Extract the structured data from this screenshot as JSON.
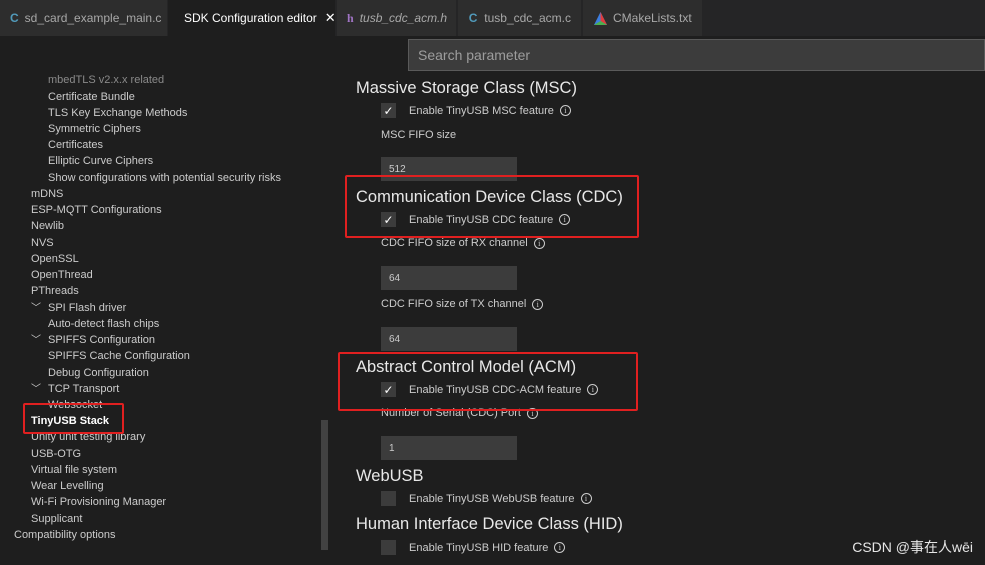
{
  "tabs": [
    {
      "label": "sd_card_example_main.c",
      "icon": "c-file-icon"
    },
    {
      "label": "SDK Configuration editor",
      "icon": "espressif-icon",
      "close": "✕"
    },
    {
      "label": "tusb_cdc_acm.h",
      "icon": "h-file-icon"
    },
    {
      "label": "tusb_cdc_acm.c",
      "icon": "c-file-icon"
    },
    {
      "label": "CMakeLists.txt",
      "icon": "cmake-icon"
    }
  ],
  "search": {
    "placeholder": "Search parameter"
  },
  "sidebar": {
    "items": [
      "mbedTLS v2.x.x related",
      "Certificate Bundle",
      "TLS Key Exchange Methods",
      "Symmetric Ciphers",
      "Certificates",
      "Elliptic Curve Ciphers",
      "Show configurations with potential security risks",
      "mDNS",
      "ESP-MQTT Configurations",
      "Newlib",
      "NVS",
      "OpenSSL",
      "OpenThread",
      "PThreads",
      "SPI Flash driver",
      "Auto-detect flash chips",
      "SPIFFS Configuration",
      "SPIFFS Cache Configuration",
      "Debug Configuration",
      "TCP Transport",
      "Websocket",
      "TinyUSB Stack",
      "Unity unit testing library",
      "USB-OTG",
      "Virtual file system",
      "Wear Levelling",
      "Wi-Fi Provisioning Manager",
      "Supplicant",
      "Compatibility options"
    ]
  },
  "main": {
    "msc": {
      "title": "Massive Storage Class (MSC)",
      "enable_label": "Enable TinyUSB MSC feature",
      "checked": "✓",
      "fifo_label": "MSC FIFO size",
      "fifo_value": "512"
    },
    "cdc": {
      "title": "Communication Device Class (CDC)",
      "enable_label": "Enable TinyUSB CDC feature",
      "checked": "✓",
      "rx_label": "CDC FIFO size of RX channel",
      "rx_value": "64",
      "tx_label": "CDC FIFO size of TX channel",
      "tx_value": "64"
    },
    "acm": {
      "title": "Abstract Control Model (ACM)",
      "enable_label": "Enable TinyUSB CDC-ACM feature",
      "checked": "✓",
      "ports_label": "Number of Serial (CDC) Port",
      "ports_value": "1"
    },
    "webusb": {
      "title": "WebUSB",
      "enable_label": "Enable TinyUSB WebUSB feature"
    },
    "hid": {
      "title": "Human Interface Device Class (HID)",
      "enable_label": "Enable TinyUSB HID feature"
    }
  },
  "info_glyph": "i",
  "watermark": "CSDN @事在人wēi",
  "colors": {
    "highlight": "#e02020",
    "background": "#1e1e1e"
  }
}
